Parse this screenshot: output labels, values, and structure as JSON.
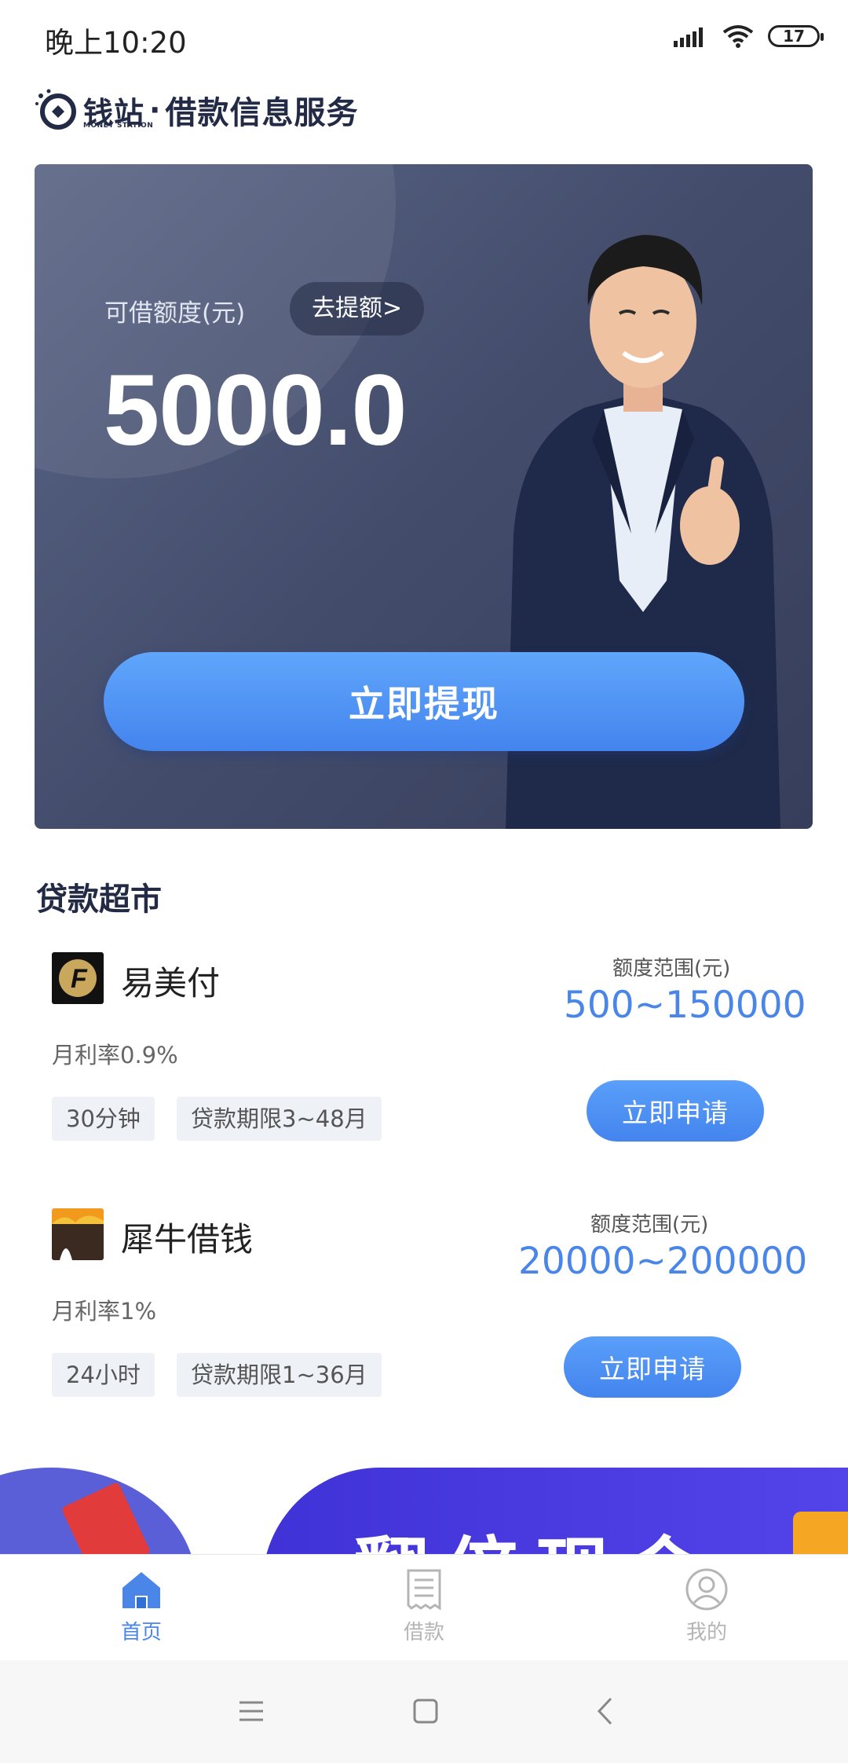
{
  "status_bar": {
    "time": "晚上10:20",
    "battery": "17"
  },
  "brand": {
    "name": "钱站",
    "name_en": "MONEY STATION",
    "separator": "·",
    "service": "借款信息服务"
  },
  "hero": {
    "label": "可借额度(元)",
    "raise_button": "去提额>",
    "amount": "5000.0",
    "withdraw_button": "立即提现"
  },
  "section": {
    "title": "贷款超市"
  },
  "loans": [
    {
      "name": "易美付",
      "rate": "月利率0.9%",
      "tags": [
        "30分钟",
        "贷款期限3~48月"
      ],
      "range_label": "额度范围(元)",
      "range": "500~150000",
      "apply": "立即申请"
    },
    {
      "name": "犀牛借钱",
      "rate": "月利率1%",
      "tags": [
        "24小时",
        "贷款期限1~36月"
      ],
      "range_label": "额度范围(元)",
      "range": "20000~200000",
      "apply": "立即申请"
    }
  ],
  "banner": {
    "text": "翻倍现金"
  },
  "tabs": [
    {
      "label": "首页",
      "icon": "home-icon",
      "active": true
    },
    {
      "label": "借款",
      "icon": "document-icon",
      "active": false
    },
    {
      "label": "我的",
      "icon": "profile-icon",
      "active": false
    }
  ],
  "colors": {
    "accent": "#4a86e8",
    "hero_bg": "#434c6b",
    "inactive": "#b5b5b5"
  }
}
